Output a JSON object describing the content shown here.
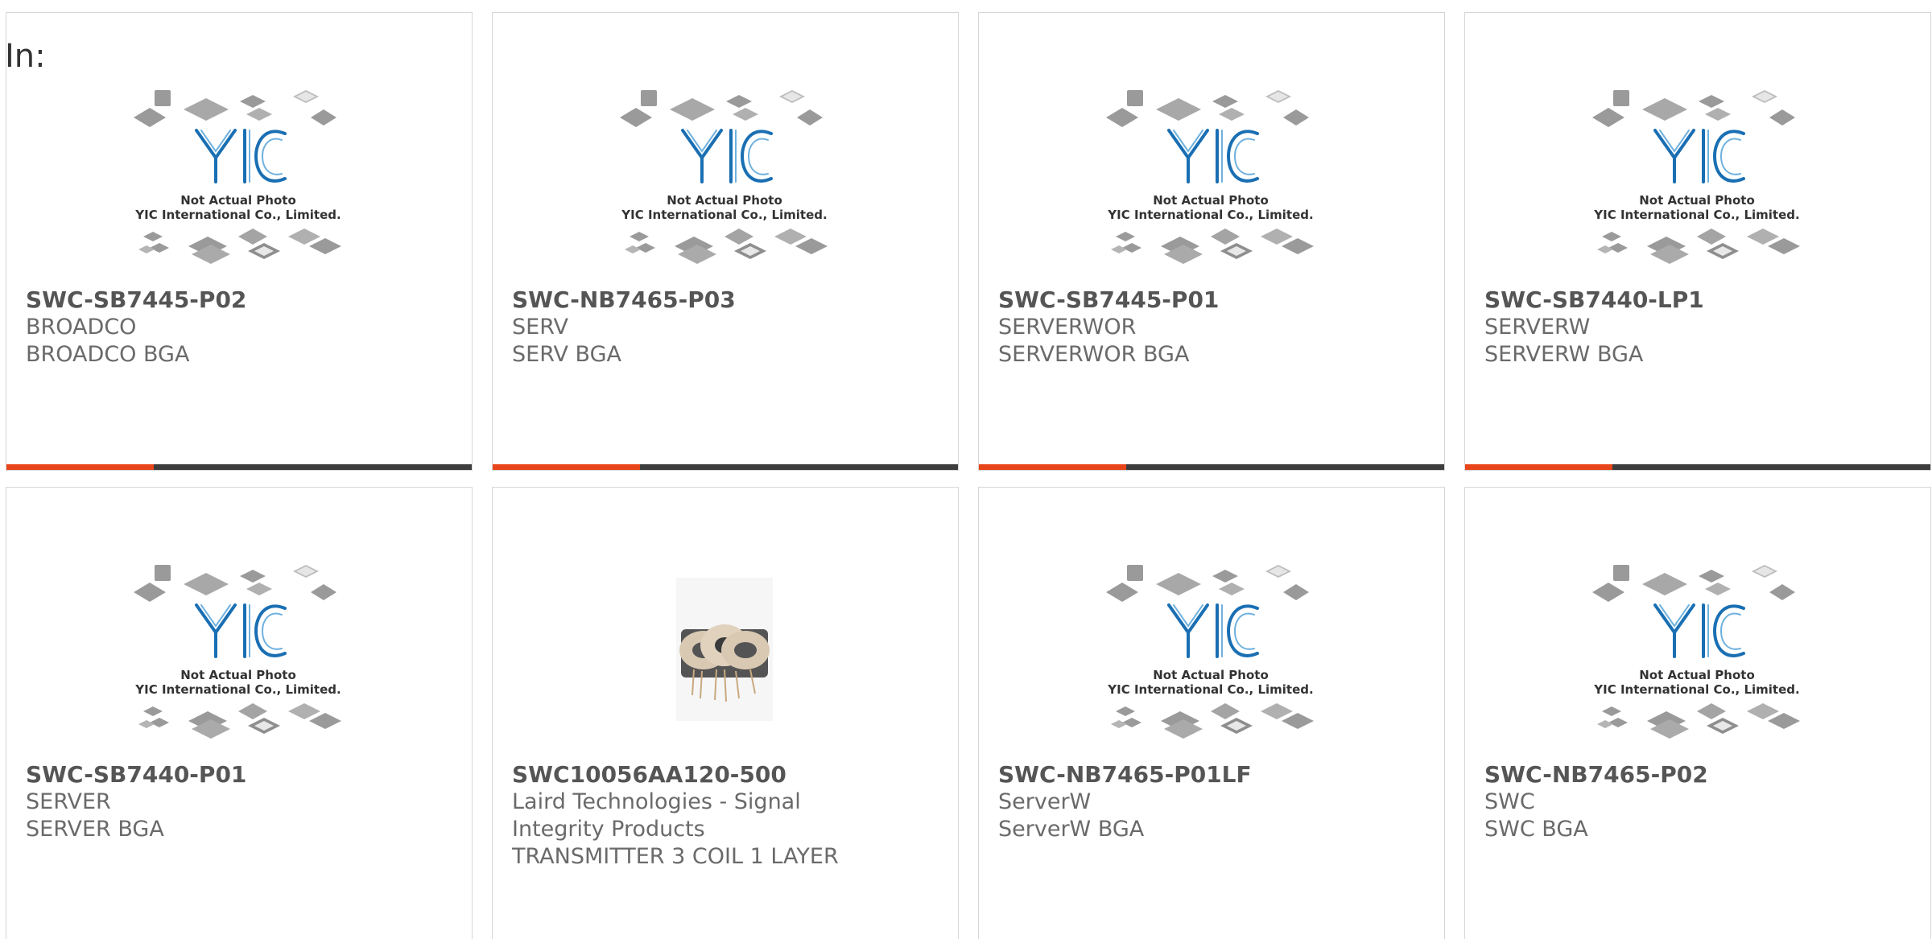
{
  "header": {
    "in_label": "In:"
  },
  "placeholder": {
    "logo_text": "YIC",
    "caption1": "Not Actual Photo",
    "caption2": "YIC International Co., Limited."
  },
  "colors": {
    "accent": "#e8461a",
    "bar": "#3d3d3d",
    "logo": "#1a6fb3"
  },
  "products": [
    {
      "part": "SWC-SB7445-P02",
      "mfr": "BROADCO",
      "desc": "BROADCO BGA",
      "image": "yic-placeholder"
    },
    {
      "part": "SWC-NB7465-P03",
      "mfr": "SERV",
      "desc": "SERV BGA",
      "image": "yic-placeholder"
    },
    {
      "part": "SWC-SB7445-P01",
      "mfr": "SERVERWOR",
      "desc": "SERVERWOR BGA",
      "image": "yic-placeholder"
    },
    {
      "part": "SWC-SB7440-LP1",
      "mfr": "SERVERW",
      "desc": "SERVERW BGA",
      "image": "yic-placeholder"
    },
    {
      "part": "SWC-SB7440-P01",
      "mfr": "SERVER",
      "desc": "SERVER BGA",
      "image": "yic-placeholder"
    },
    {
      "part": "SWC10056AA120-500",
      "mfr_line1": "Laird Technologies - Signal",
      "mfr_line2": "Integrity Products",
      "desc": "TRANSMITTER 3 COIL 1 LAYER",
      "image": "coil-photo"
    },
    {
      "part": "SWC-NB7465-P01LF",
      "mfr": "ServerW",
      "desc": "ServerW BGA",
      "image": "yic-placeholder"
    },
    {
      "part": "SWC-NB7465-P02",
      "mfr": "SWC",
      "desc": "SWC BGA",
      "image": "yic-placeholder"
    }
  ]
}
